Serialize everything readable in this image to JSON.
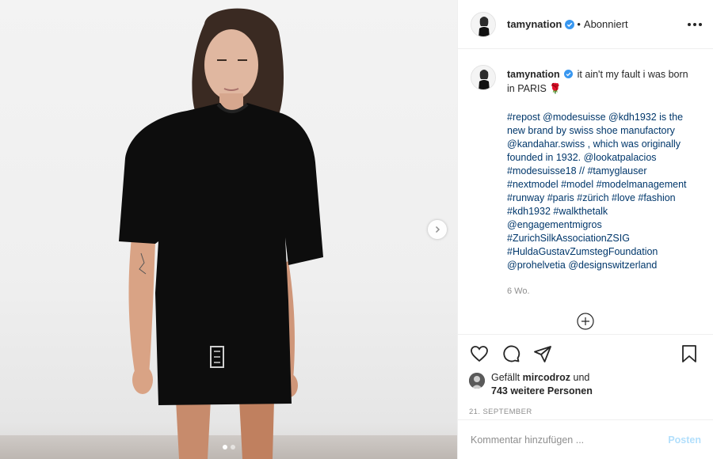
{
  "post": {
    "image_alt": "Model walking a runway in an oversized black T-shirt dress",
    "carousel": {
      "total": 2,
      "active": 1
    }
  },
  "header": {
    "username": "tamynation",
    "separator": "•",
    "follow_status": "Abonniert"
  },
  "caption": {
    "username": "tamynation",
    "headline": "it ain't my fault i was born in PARIS 🌹",
    "body": "#repost @modesuisse @kdh1932 is the new brand by swiss shoe manufactory @kandahar.swiss , which was originally founded in 1932. @lookatpalacios #modesuisse18 // #tamyglauser #nextmodel #model #modelmanagement #runway #paris #zürich #love #fashion #kdh1932 #walkthetalk @engagementmigros #ZurichSilkAssociationZSIG #HuldaGustavZumstegFoundation @prohelvetia @designswitzerland",
    "time": "6 Wo."
  },
  "likes": {
    "prefix": "Gefällt ",
    "user": "mircodroz",
    "connector": " und",
    "others": "743 weitere Personen"
  },
  "date": "21. SEPTEMBER",
  "comment": {
    "placeholder": "Kommentar hinzufügen ...",
    "post_label": "Posten"
  },
  "colors": {
    "text": "#262626",
    "link": "#00376b",
    "muted": "#8e8e8e",
    "verified": "#3897f0",
    "post_disabled": "#b2dffc"
  },
  "icons": [
    "verified-badge-icon",
    "more-options-icon",
    "heart-icon",
    "comment-icon",
    "share-icon",
    "bookmark-icon",
    "load-more-icon",
    "carousel-next-icon"
  ]
}
